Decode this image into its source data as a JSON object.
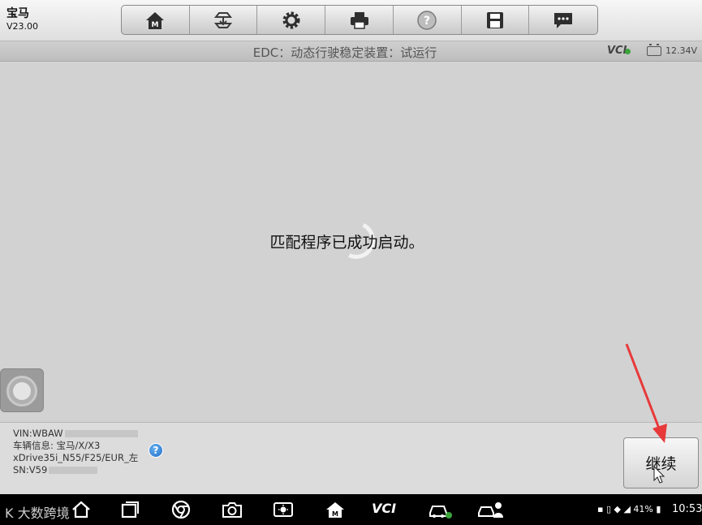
{
  "app": {
    "brand": "宝马",
    "version": "V23.00"
  },
  "toolbar": {
    "buttons": [
      {
        "name": "home-icon"
      },
      {
        "name": "vehicle-swap-icon"
      },
      {
        "name": "settings-gear-icon"
      },
      {
        "name": "print-icon"
      },
      {
        "name": "help-icon"
      },
      {
        "name": "save-icon"
      },
      {
        "name": "message-icon"
      }
    ]
  },
  "header": {
    "title": "EDC：动态行驶稳定装置：试运行",
    "vci_label": "VCI",
    "voltage": "12.34V"
  },
  "main": {
    "message": "匹配程序已成功启动。"
  },
  "vehicle_info": {
    "vin": "VIN:WBAW",
    "info": "车辆信息: 宝马/X/X3",
    "model": "xDrive35i_N55/F25/EUR_左",
    "sn": "SN:V59"
  },
  "actions": {
    "continue_label": "继续"
  },
  "navbar": {
    "watermark": "K 大数跨境",
    "battery": "41%",
    "time": "10:53",
    "vci_label": "VCI"
  },
  "colors": {
    "accent_green": "#3aa43a",
    "arrow_red": "#e8393a",
    "help_blue": "#1f6fc6"
  }
}
